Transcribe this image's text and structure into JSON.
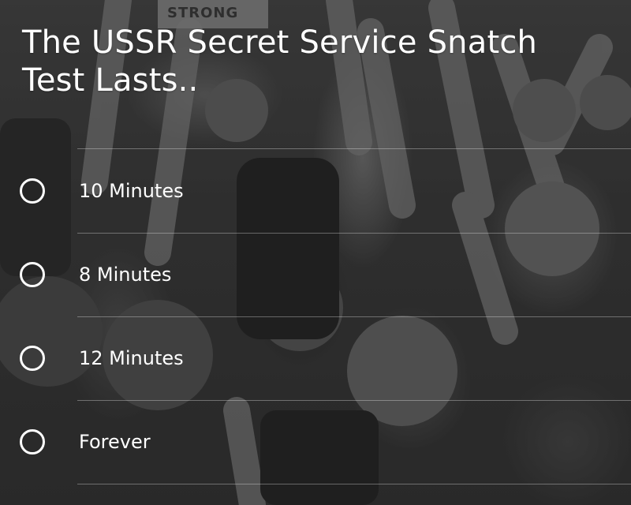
{
  "quiz": {
    "question": "The USSR Secret Service Snatch Test Lasts..",
    "options": [
      {
        "label": "10 Minutes"
      },
      {
        "label": "8 Minutes"
      },
      {
        "label": "12 Minutes"
      },
      {
        "label": "Forever"
      }
    ]
  },
  "background": {
    "sign_text": "STRONG"
  },
  "colors": {
    "text": "#ffffff",
    "divider": "rgba(255,255,255,0.32)"
  }
}
